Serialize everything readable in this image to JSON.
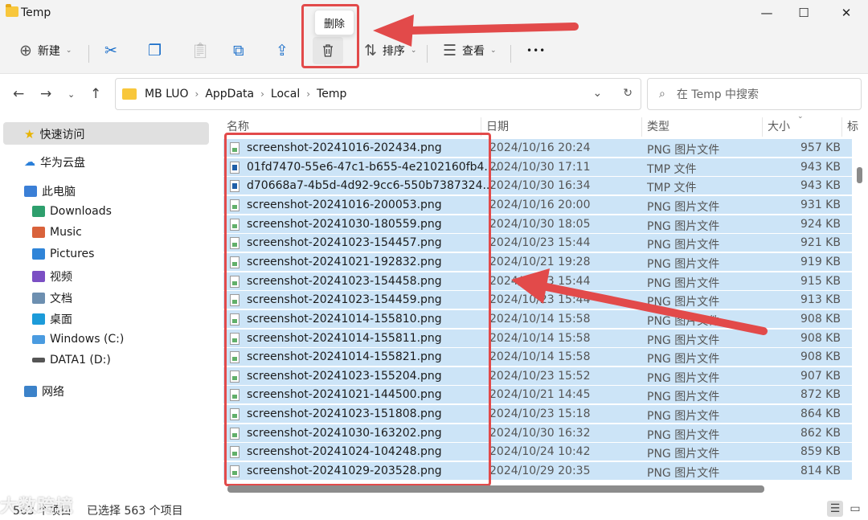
{
  "window": {
    "title": "Temp",
    "minimize_glyph": "—",
    "maximize_glyph": "☐",
    "close_glyph": "✕"
  },
  "toolbar": {
    "new_label": "新建",
    "sort_label": "排序",
    "view_label": "查看",
    "more_glyph": "•••",
    "delete_tooltip": "删除"
  },
  "breadcrumbs": [
    "MB LUO",
    "AppData",
    "Local",
    "Temp"
  ],
  "search": {
    "placeholder": "在 Temp 中搜索"
  },
  "sidebar": {
    "items": [
      {
        "label": "快速访问",
        "icon": "star-icon"
      },
      {
        "label": "华为云盘",
        "icon": "cloud-icon"
      },
      {
        "label": "此电脑",
        "icon": "computer-icon"
      },
      {
        "label": "Downloads",
        "icon": "downloads-icon"
      },
      {
        "label": "Music",
        "icon": "music-icon"
      },
      {
        "label": "Pictures",
        "icon": "pictures-icon"
      },
      {
        "label": "视频",
        "icon": "videos-icon"
      },
      {
        "label": "文档",
        "icon": "documents-icon"
      },
      {
        "label": "桌面",
        "icon": "desktop-icon"
      },
      {
        "label": "Windows (C:)",
        "icon": "drive-c-icon"
      },
      {
        "label": "DATA1 (D:)",
        "icon": "drive-d-icon"
      },
      {
        "label": "网络",
        "icon": "network-icon"
      }
    ]
  },
  "columns": [
    "名称",
    "日期",
    "类型",
    "大小",
    "标"
  ],
  "files": [
    {
      "name": "screenshot-20241016-202434.png",
      "date": "2024/10/16 20:24",
      "type": "PNG 图片文件",
      "size": "957 KB",
      "kind": "png"
    },
    {
      "name": "01fd7470-55e6-47c1-b655-4e2102160fb4....",
      "date": "2024/10/30 17:11",
      "type": "TMP 文件",
      "size": "943 KB",
      "kind": "tmp"
    },
    {
      "name": "d70668a7-4b5d-4d92-9cc6-550b7387324...",
      "date": "2024/10/30 16:34",
      "type": "TMP 文件",
      "size": "943 KB",
      "kind": "tmp"
    },
    {
      "name": "screenshot-20241016-200053.png",
      "date": "2024/10/16 20:00",
      "type": "PNG 图片文件",
      "size": "931 KB",
      "kind": "png"
    },
    {
      "name": "screenshot-20241030-180559.png",
      "date": "2024/10/30 18:05",
      "type": "PNG 图片文件",
      "size": "924 KB",
      "kind": "png"
    },
    {
      "name": "screenshot-20241023-154457.png",
      "date": "2024/10/23 15:44",
      "type": "PNG 图片文件",
      "size": "921 KB",
      "kind": "png"
    },
    {
      "name": "screenshot-20241021-192832.png",
      "date": "2024/10/21 19:28",
      "type": "PNG 图片文件",
      "size": "919 KB",
      "kind": "png"
    },
    {
      "name": "screenshot-20241023-154458.png",
      "date": "2024/10/23 15:44",
      "type": "PNG 图片文件",
      "size": "915 KB",
      "kind": "png"
    },
    {
      "name": "screenshot-20241023-154459.png",
      "date": "2024/10/23 15:44",
      "type": "PNG 图片文件",
      "size": "913 KB",
      "kind": "png"
    },
    {
      "name": "screenshot-20241014-155810.png",
      "date": "2024/10/14 15:58",
      "type": "PNG 图片文件",
      "size": "908 KB",
      "kind": "png"
    },
    {
      "name": "screenshot-20241014-155811.png",
      "date": "2024/10/14 15:58",
      "type": "PNG 图片文件",
      "size": "908 KB",
      "kind": "png"
    },
    {
      "name": "screenshot-20241014-155821.png",
      "date": "2024/10/14 15:58",
      "type": "PNG 图片文件",
      "size": "908 KB",
      "kind": "png"
    },
    {
      "name": "screenshot-20241023-155204.png",
      "date": "2024/10/23 15:52",
      "type": "PNG 图片文件",
      "size": "907 KB",
      "kind": "png"
    },
    {
      "name": "screenshot-20241021-144500.png",
      "date": "2024/10/21 14:45",
      "type": "PNG 图片文件",
      "size": "872 KB",
      "kind": "png"
    },
    {
      "name": "screenshot-20241023-151808.png",
      "date": "2024/10/23 15:18",
      "type": "PNG 图片文件",
      "size": "864 KB",
      "kind": "png"
    },
    {
      "name": "screenshot-20241030-163202.png",
      "date": "2024/10/30 16:32",
      "type": "PNG 图片文件",
      "size": "862 KB",
      "kind": "png"
    },
    {
      "name": "screenshot-20241024-104248.png",
      "date": "2024/10/24 10:42",
      "type": "PNG 图片文件",
      "size": "859 KB",
      "kind": "png"
    },
    {
      "name": "screenshot-20241029-203528.png",
      "date": "2024/10/29 20:35",
      "type": "PNG 图片文件",
      "size": "814 KB",
      "kind": "png"
    }
  ],
  "status": {
    "item_count": "563 个项目",
    "selected": "已选择 563 个项目"
  },
  "watermark": "大数跨境",
  "colors": {
    "selection": "#cce4f7",
    "annotation_red": "#e24a4a",
    "toolbar_bg": "#f3f3f3"
  }
}
